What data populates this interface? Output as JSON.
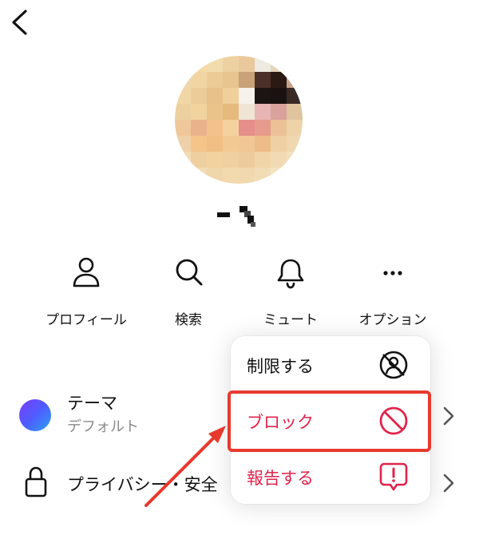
{
  "colors": {
    "accent_red": "#e0244c",
    "annotation_red": "#e8392e",
    "text": "#111111",
    "muted": "#8a8a8a"
  },
  "actions": [
    {
      "label": "プロフィール",
      "icon": "person-icon"
    },
    {
      "label": "検索",
      "icon": "search-icon"
    },
    {
      "label": "ミュート",
      "icon": "bell-icon"
    },
    {
      "label": "オプション",
      "icon": "more-icon"
    }
  ],
  "settings": {
    "theme": {
      "title": "テーマ",
      "value": "デフォルト"
    },
    "privacy": {
      "title": "プライバシー・安全"
    }
  },
  "menu": {
    "restrict": "制限する",
    "block": "ブロック",
    "report": "報告する"
  }
}
